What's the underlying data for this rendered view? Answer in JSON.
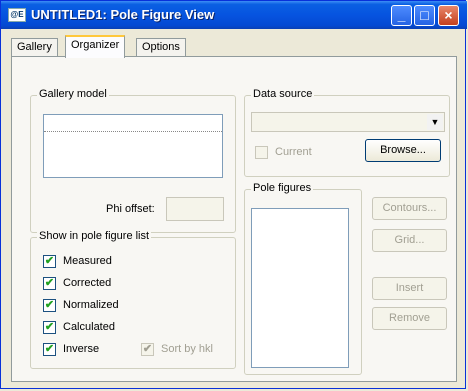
{
  "window": {
    "title": "UNTITLED1: Pole Figure View",
    "icon_text": "@E"
  },
  "titlebar": {
    "minimize": "_",
    "maximize": "□",
    "close": "×"
  },
  "tabs": [
    {
      "label": "Gallery"
    },
    {
      "label": "Organizer"
    },
    {
      "label": "Options"
    }
  ],
  "gallery_model": {
    "label": "Gallery model",
    "phi_offset_label": "Phi offset:"
  },
  "data_source": {
    "label": "Data source",
    "current_label": "Current",
    "browse_label": "Browse..."
  },
  "pole_figures": {
    "label": "Pole figures",
    "contours_label": "Contours...",
    "grid_label": "Grid...",
    "insert_label": "Insert",
    "remove_label": "Remove"
  },
  "show_list": {
    "label": "Show in pole figure list",
    "items": [
      {
        "label": "Measured",
        "checked": "✔"
      },
      {
        "label": "Corrected",
        "checked": "✔"
      },
      {
        "label": "Normalized",
        "checked": "✔"
      },
      {
        "label": "Calculated",
        "checked": "✔"
      },
      {
        "label": "Inverse",
        "checked": "✔"
      }
    ],
    "sort_by_hkl_label": "Sort by hkl",
    "sort_by_hkl_checked": "✔"
  }
}
